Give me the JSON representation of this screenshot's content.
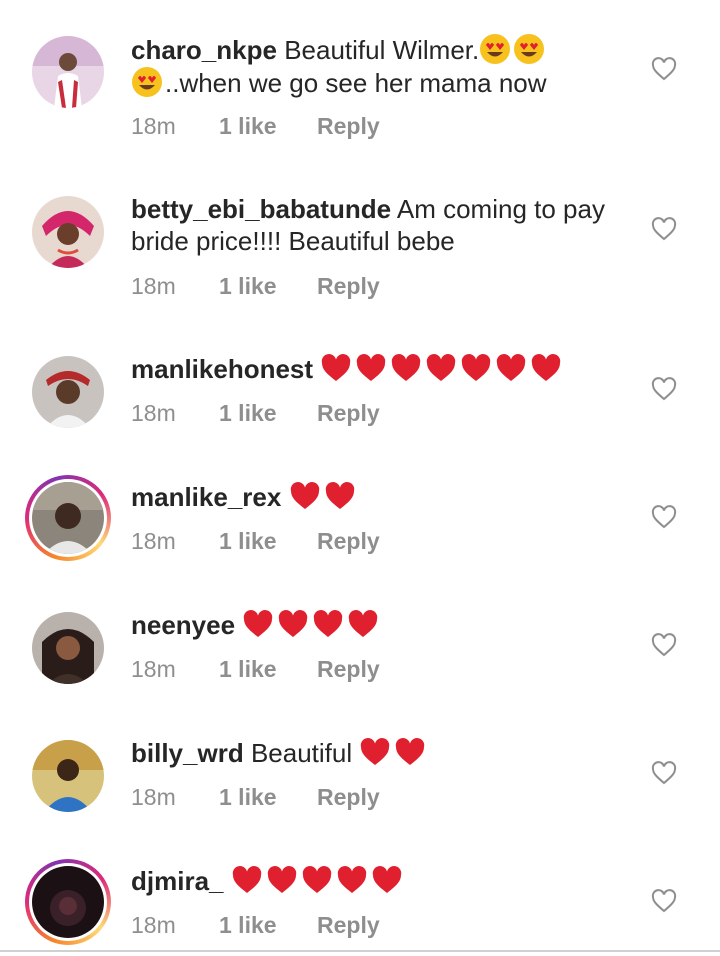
{
  "comments": [
    {
      "username": "charo_nkpe",
      "text": "Beautiful Wilmer.",
      "text2": "..when we go see her mama now",
      "time": "18m",
      "likes": "1 like",
      "reply": "Reply",
      "avatar_color": "#c8a6c9",
      "story_ring": false,
      "emoji": "smiling-face-heart-eyes"
    },
    {
      "username": "betty_ebi_babatunde",
      "text": "Am coming to pay bride price!!!! Beautiful bebe",
      "time": "18m",
      "likes": "1 like",
      "reply": "Reply",
      "avatar_color": "#d23a6e",
      "story_ring": false
    },
    {
      "username": "manlikehonest",
      "text": "",
      "hearts": 7,
      "time": "18m",
      "likes": "1 like",
      "reply": "Reply",
      "avatar_color": "#5a4a44",
      "story_ring": false
    },
    {
      "username": "manlike_rex",
      "text": "",
      "hearts": 2,
      "time": "18m",
      "likes": "1 like",
      "reply": "Reply",
      "avatar_color": "#6b6158",
      "story_ring": true
    },
    {
      "username": "neenyee",
      "text": "",
      "hearts": 4,
      "time": "18m",
      "likes": "1 like",
      "reply": "Reply",
      "avatar_color": "#7a6e68",
      "story_ring": false
    },
    {
      "username": "billy_wrd",
      "text": "Beautiful",
      "hearts": 2,
      "time": "18m",
      "likes": "1 like",
      "reply": "Reply",
      "avatar_color": "#3e7fb8",
      "story_ring": false
    },
    {
      "username": "djmira_",
      "text": "",
      "hearts": 5,
      "time": "18m",
      "likes": "1 like",
      "reply": "Reply",
      "avatar_color": "#1e1418",
      "story_ring": true
    }
  ],
  "colors": {
    "text": "#262626",
    "meta": "#8e8e8e",
    "heart": "#e0202e"
  },
  "icons": {
    "like": "heart-outline-icon",
    "emoji_heart": "red-heart-emoji",
    "emoji_face": "heart-eyes-emoji"
  }
}
